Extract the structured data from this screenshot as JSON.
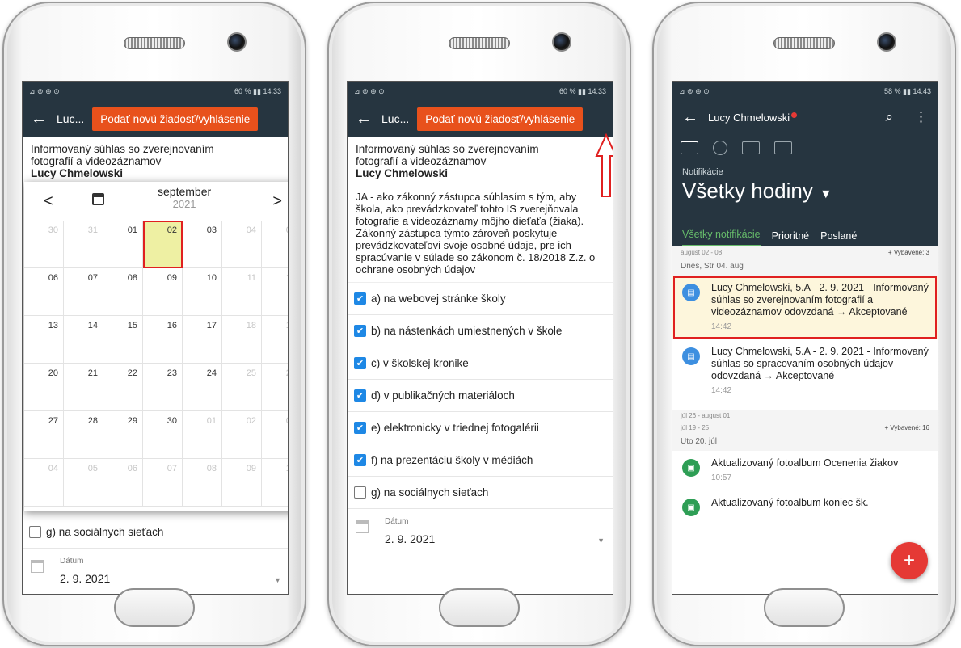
{
  "phone1": {
    "status_left": "⊿ ⊜ ⊕ ⊙",
    "status_right": "60 % ▮▮ 14:33",
    "back": "←",
    "title_short": "Luc...",
    "action_button": "Podať novú žiadosť/vyhlásenie",
    "doc_title_l1": "Informovaný súhlas so zverejnovaním",
    "doc_title_l2": "fotografií a videozáznamov",
    "doc_name": "Lucy Chmelowski",
    "calendar": {
      "month": "september",
      "year": "2021",
      "prev": "<",
      "next": ">",
      "days": [
        "30",
        "31",
        "01",
        "02",
        "03",
        "04",
        "05",
        "06",
        "07",
        "08",
        "09",
        "10",
        "11",
        "12",
        "13",
        "14",
        "15",
        "16",
        "17",
        "18",
        "19",
        "20",
        "21",
        "22",
        "23",
        "24",
        "25",
        "26",
        "27",
        "28",
        "29",
        "30",
        "01",
        "02",
        "03",
        "04",
        "05",
        "06",
        "07",
        "08",
        "09",
        "10"
      ],
      "selected": "02"
    },
    "g_label": "g) na sociálnych sieťach",
    "date_label": "Dátum",
    "date_value": "2. 9. 2021",
    "dropdown_arrow": "▼"
  },
  "phone2": {
    "status_left": "⊿ ⊜ ⊕ ⊙",
    "status_right": "60 % ▮▮ 14:33",
    "back": "←",
    "title_short": "Luc...",
    "action_button": "Podať novú žiadosť/vyhlásenie",
    "doc_title_l1": "Informovaný súhlas so zverejnovaním",
    "doc_title_l2": "fotografií a videozáznamov",
    "doc_name": "Lucy Chmelowski",
    "consent_text": "JA - ako zákonný zástupca súhlasím s tým, aby škola, ako prevádzkovateľ tohto IS zverejňovala fotografie a videozáznamy môjho dieťaťa (žiaka).\nZákonný zástupca týmto zároveň poskytuje prevádzkovateľovi svoje osobné údaje, pre ich spracúvanie v súlade so zákonom č. 18/2018 Z.z. o ochrane osobných údajov",
    "options": [
      {
        "label": "a) na webovej stránke školy",
        "checked": true
      },
      {
        "label": "b) na nástenkách umiestnených v škole",
        "checked": true
      },
      {
        "label": "c) v školskej kronike",
        "checked": true
      },
      {
        "label": "d) v publikačných materiáloch",
        "checked": true
      },
      {
        "label": "e) elektronicky v triednej fotogalérii",
        "checked": true
      },
      {
        "label": "f) na prezentáciu školy v médiách",
        "checked": true
      },
      {
        "label": "g) na sociálnych sieťach",
        "checked": false
      }
    ],
    "date_label": "Dátum",
    "date_value": "2. 9. 2021",
    "dropdown_arrow": "▼"
  },
  "phone3": {
    "status_left": "⊿ ⊜ ⊕ ⊙",
    "status_right": "58 % ▮▮ 14:43",
    "back": "←",
    "title": "Lucy Chmelowski",
    "search": "⌕",
    "menu": "⋮",
    "small_label": "Notifikácie",
    "big_title": "Všetky hodiny",
    "caret": "▼",
    "subtabs": [
      "Všetky notifikácie",
      "Prioritné",
      "Poslané"
    ],
    "group1": {
      "range": "august 02 - 08",
      "selected": "+ Vybavené: 3"
    },
    "day1": "Dnes, Str 04. aug",
    "notif1": {
      "text": "Lucy Chmelowski, 5.A - 2. 9. 2021 - Informovaný súhlas so zverejnovaním fotografií a videozáznamov odovzdaná → Akceptované",
      "time": "14:42"
    },
    "notif2": {
      "text": "Lucy Chmelowski, 5.A - 2. 9. 2021 - Informovaný súhlas so spracovaním osobných údajov odovzdaná → Akceptované",
      "time": "14:42"
    },
    "group2": {
      "range": "júl 26 - august 01"
    },
    "group3": {
      "range": "júl 19 - 25",
      "selected": "+ Vybavené: 16"
    },
    "day2": "Uto 20. júl",
    "notif3": {
      "text": "Aktualizovaný fotoalbum Ocenenia žiakov",
      "time": "10:57"
    },
    "notif4": {
      "text": "Aktualizovaný fotoalbum koniec šk."
    },
    "fab": "+"
  }
}
